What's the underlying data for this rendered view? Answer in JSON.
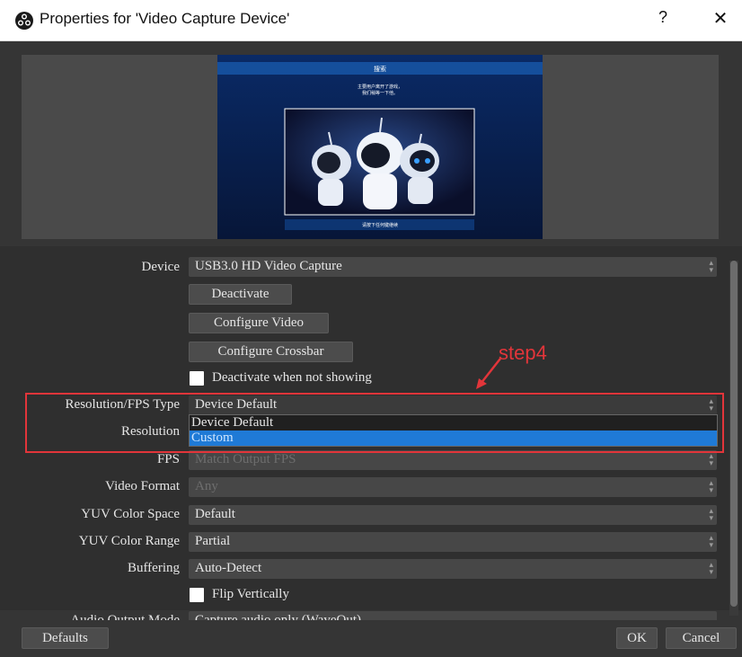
{
  "window": {
    "title": "Properties for 'Video Capture Device'",
    "help_label": "?",
    "close_label": "✕"
  },
  "preview": {
    "screen_title": "搜索",
    "screen_message_line1": "主要用户离开了游戏，",
    "screen_message_line2": "我们稍等一下他。",
    "screen_footer": "请按下任何键继续"
  },
  "properties": {
    "device_label": "Device",
    "device_value": "USB3.0 HD Video Capture",
    "deactivate_button": "Deactivate",
    "configure_video_button": "Configure Video",
    "configure_crossbar_button": "Configure Crossbar",
    "deactivate_when_not_showing_label": "Deactivate when not showing",
    "resolution_fps_type_label": "Resolution/FPS Type",
    "resolution_fps_type_value": "Device Default",
    "resolution_label": "Resolution",
    "fps_label": "FPS",
    "fps_value": "Match Output FPS",
    "video_format_label": "Video Format",
    "video_format_value": "Any",
    "yuv_color_space_label": "YUV Color Space",
    "yuv_color_space_value": "Default",
    "yuv_color_range_label": "YUV Color Range",
    "yuv_color_range_value": "Partial",
    "buffering_label": "Buffering",
    "buffering_value": "Auto-Detect",
    "flip_vertically_label": "Flip Vertically",
    "partial_row_label": "Audio Output Mode",
    "partial_row_value": "Capture audio only (WaveOut)"
  },
  "dropdown": {
    "options": [
      "Device Default",
      "Custom"
    ],
    "selected_index": 1
  },
  "annotation": {
    "step_label": "step4",
    "color": "#e2353a"
  },
  "footer": {
    "defaults_button": "Defaults",
    "ok_button": "OK",
    "cancel_button": "Cancel"
  },
  "colors": {
    "dialog_bg": "#353535",
    "props_bg": "#2f2f2f",
    "control_bg": "#474747",
    "selection_blue": "#1f7ad6"
  }
}
